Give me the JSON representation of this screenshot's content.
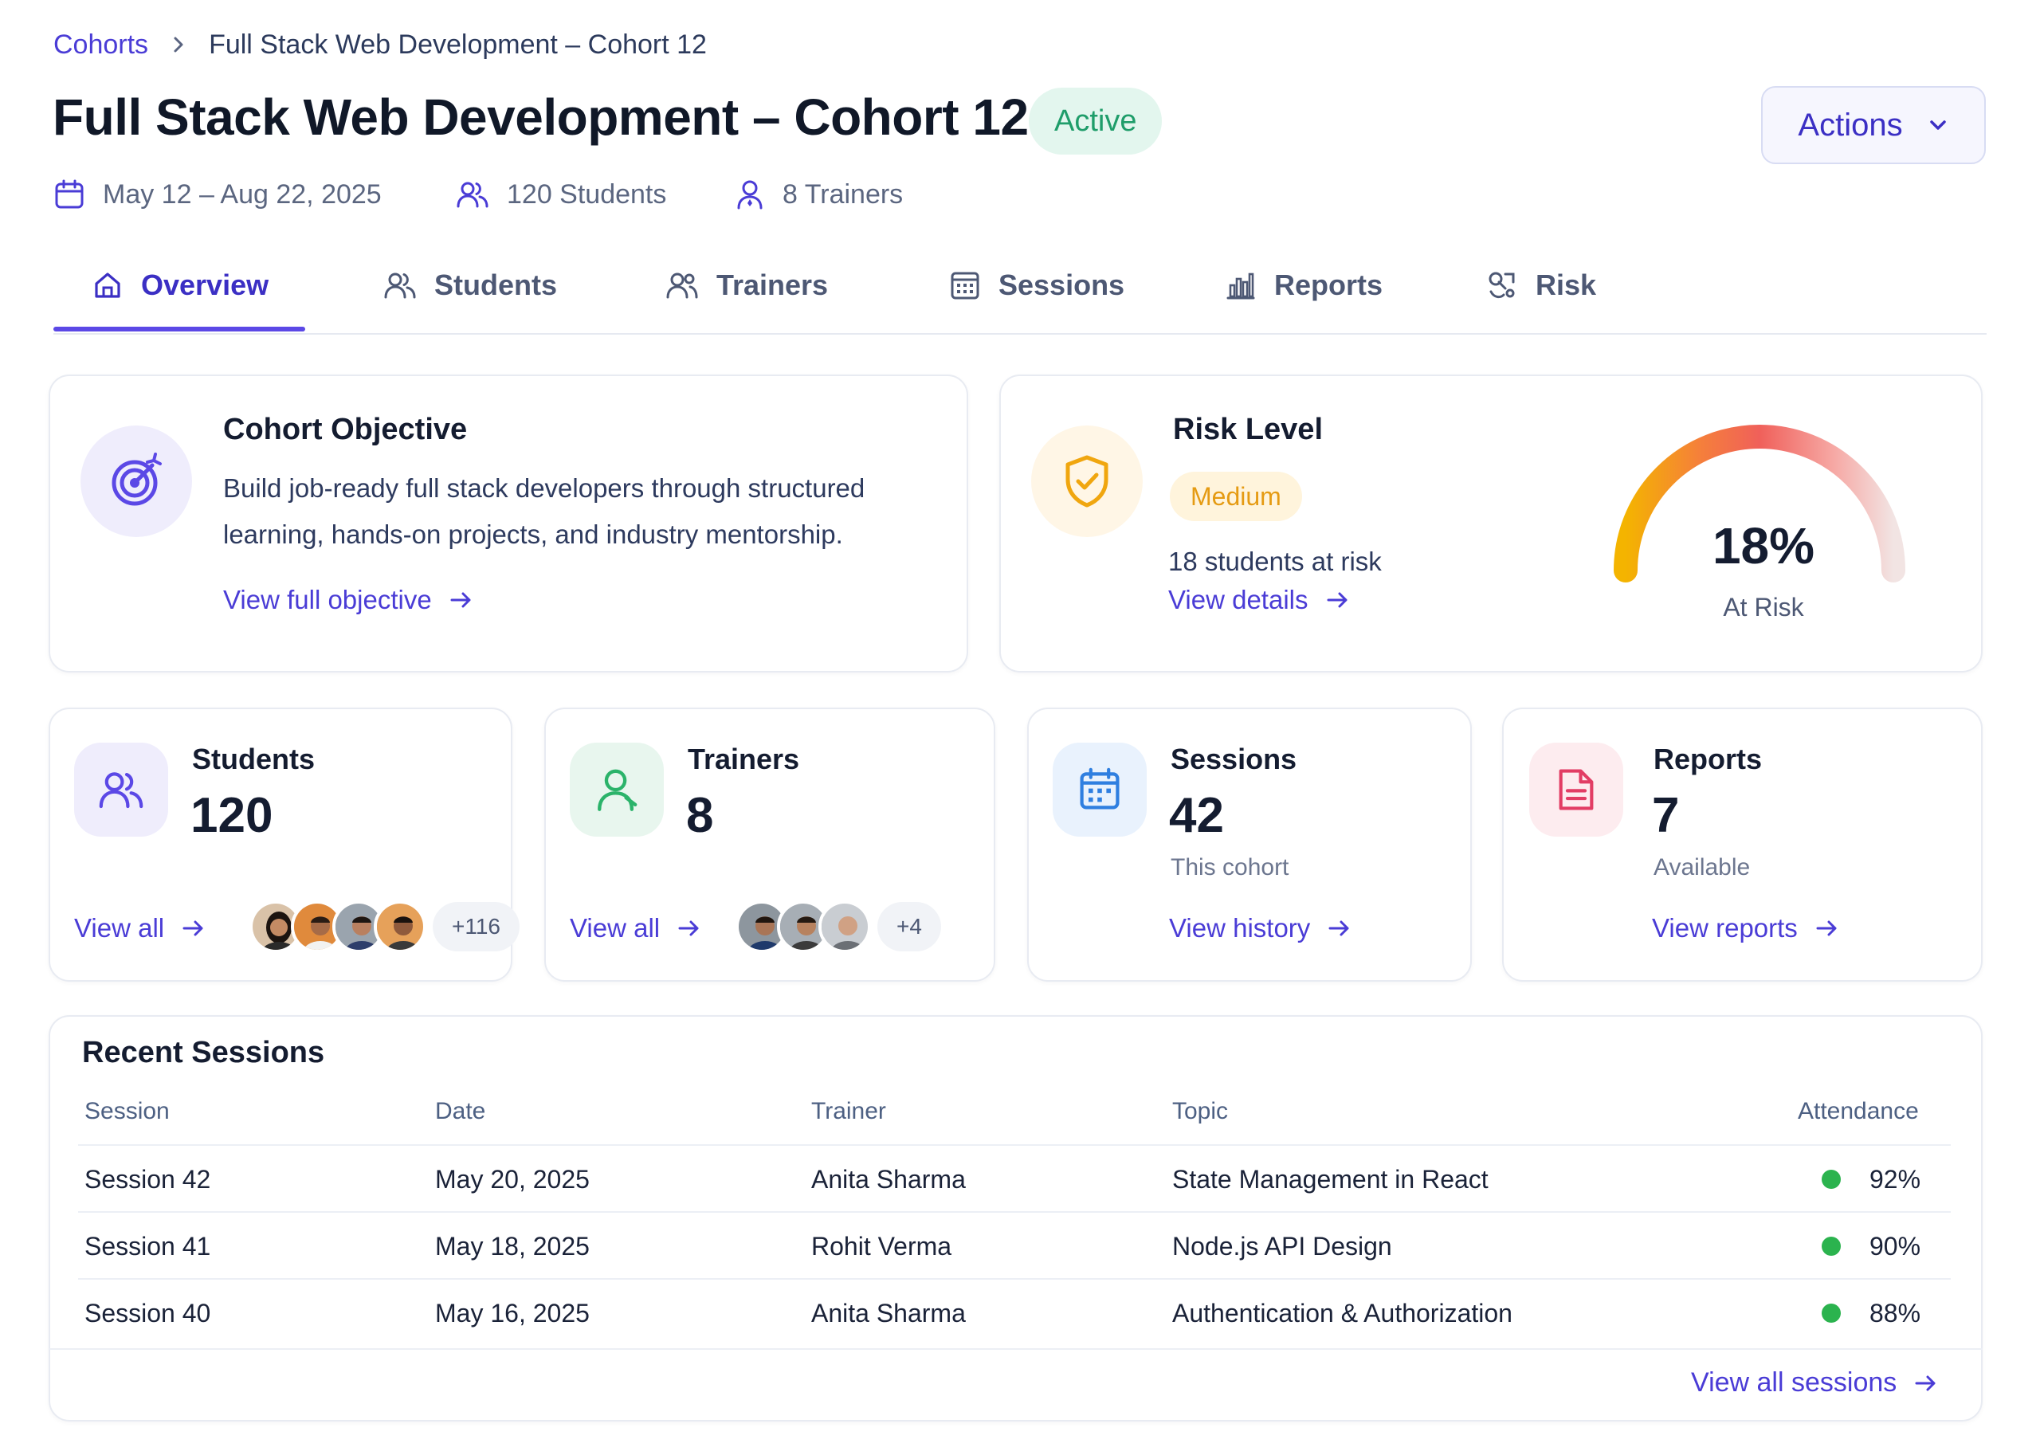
{
  "breadcrumb": {
    "root": "Cohorts",
    "current": "Full Stack Web Development – Cohort 12"
  },
  "header": {
    "title": "Full Stack Web Development – Cohort 12",
    "status": "Active",
    "actions_label": "Actions",
    "dates": "May 12 – Aug 22, 2025",
    "students": "120 Students",
    "trainers": "8 Trainers"
  },
  "tabs": [
    {
      "label": "Overview",
      "icon": "home-icon",
      "active": true
    },
    {
      "label": "Students",
      "icon": "users-icon"
    },
    {
      "label": "Trainers",
      "icon": "trainers-icon"
    },
    {
      "label": "Sessions",
      "icon": "calendar-grid-icon"
    },
    {
      "label": "Reports",
      "icon": "bar-chart-icon"
    },
    {
      "label": "Risk",
      "icon": "risk-icon"
    }
  ],
  "objective": {
    "title": "Cohort Objective",
    "line1": "Build job-ready full stack developers through structured",
    "line2": "learning, hands-on projects, and industry mentorship.",
    "link": "View full objective"
  },
  "risk": {
    "title": "Risk Level",
    "level": "Medium",
    "students_at_risk": "18 students at risk",
    "link": "View details",
    "percent_label": "18%",
    "percent_value": 0.18,
    "gauge_caption": "At Risk",
    "colors": {
      "high": "#f0605a",
      "mid": "#f4b400",
      "low": "#f8d5d2"
    }
  },
  "stats": {
    "students": {
      "title": "Students",
      "value": "120",
      "link": "View all",
      "extra": "+116"
    },
    "trainers": {
      "title": "Trainers",
      "value": "8",
      "link": "View all",
      "extra": "+4"
    },
    "sessions": {
      "title": "Sessions",
      "value": "42",
      "sub": "This cohort",
      "link": "View history"
    },
    "reports": {
      "title": "Reports",
      "value": "7",
      "sub": "Available",
      "link": "View reports"
    }
  },
  "recent_sessions": {
    "title": "Recent Sessions",
    "columns": {
      "session": "Session",
      "date": "Date",
      "trainer": "Trainer",
      "topic": "Topic",
      "attendance": "Attendance"
    },
    "rows": [
      {
        "session": "Session 42",
        "date": "May 20, 2025",
        "trainer": "Anita Sharma",
        "topic": "State Management in React",
        "attendance": "92%"
      },
      {
        "session": "Session 41",
        "date": "May 18, 2025",
        "trainer": "Rohit Verma",
        "topic": "Node.js API Design",
        "attendance": "90%"
      },
      {
        "session": "Session 40",
        "date": "May 16, 2025",
        "trainer": "Anita Sharma",
        "topic": "Authentication & Authorization",
        "attendance": "88%"
      }
    ],
    "footer_link": "View all sessions"
  },
  "colors": {
    "accent": "#4a3cd6",
    "active_badge": "#1f9d6a",
    "medium": "#e59b13",
    "attendance_good": "#2bb34e"
  }
}
